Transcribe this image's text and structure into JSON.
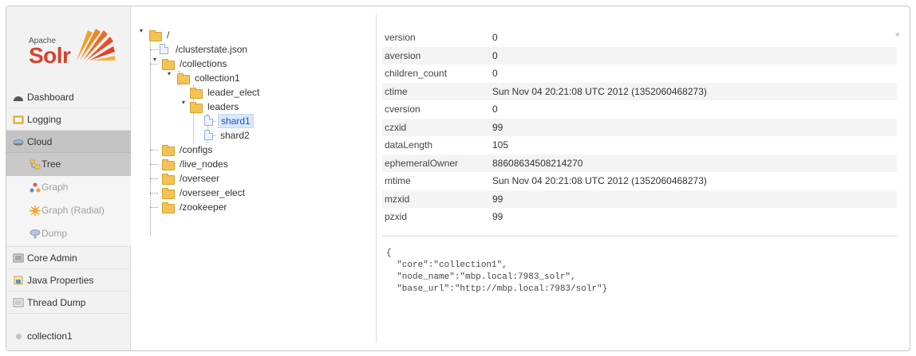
{
  "logo": {
    "apache": "Apache",
    "solr": "Solr"
  },
  "sidebar": {
    "items": [
      {
        "label": "Dashboard",
        "icon": "dashboard-icon"
      },
      {
        "label": "Logging",
        "icon": "logging-icon"
      },
      {
        "label": "Cloud",
        "icon": "cloud-icon",
        "active": true
      }
    ],
    "cloud_sub": [
      {
        "label": "Tree",
        "icon": "tree-icon",
        "selected": true
      },
      {
        "label": "Graph",
        "icon": "graph-icon"
      },
      {
        "label": "Graph (Radial)",
        "icon": "graph-radial-icon"
      },
      {
        "label": "Dump",
        "icon": "dump-icon"
      }
    ],
    "items2": [
      {
        "label": "Core Admin",
        "icon": "core-admin-icon"
      },
      {
        "label": "Java Properties",
        "icon": "java-properties-icon"
      },
      {
        "label": "Thread Dump",
        "icon": "thread-dump-icon"
      }
    ],
    "core": "collection1"
  },
  "tree": {
    "root": "/",
    "nodes": [
      {
        "label": "/clusterstate.json",
        "type": "file"
      },
      {
        "label": "/collections",
        "type": "folder"
      },
      {
        "label": "collection1",
        "type": "folder"
      },
      {
        "label": "leader_elect",
        "type": "folder"
      },
      {
        "label": "leaders",
        "type": "folder"
      },
      {
        "label": "shard1",
        "type": "file",
        "selected": true
      },
      {
        "label": "shard2",
        "type": "file"
      },
      {
        "label": "/configs",
        "type": "folder"
      },
      {
        "label": "/live_nodes",
        "type": "folder"
      },
      {
        "label": "/overseer",
        "type": "folder"
      },
      {
        "label": "/overseer_elect",
        "type": "folder"
      },
      {
        "label": "/zookeeper",
        "type": "folder"
      }
    ]
  },
  "properties": [
    {
      "key": "version",
      "value": "0"
    },
    {
      "key": "aversion",
      "value": "0"
    },
    {
      "key": "children_count",
      "value": "0"
    },
    {
      "key": "ctime",
      "value": "Sun Nov 04 20:21:08 UTC 2012 (1352060468273)"
    },
    {
      "key": "cversion",
      "value": "0"
    },
    {
      "key": "czxid",
      "value": "99"
    },
    {
      "key": "dataLength",
      "value": "105"
    },
    {
      "key": "ephemeralOwner",
      "value": "88608634508214270"
    },
    {
      "key": "mtime",
      "value": "Sun Nov 04 20:21:08 UTC 2012 (1352060468273)"
    },
    {
      "key": "mzxid",
      "value": "99"
    },
    {
      "key": "pzxid",
      "value": "99"
    }
  ],
  "close_label": "×",
  "json_content": "{\n  \"core\":\"collection1\",\n  \"node_name\":\"mbp.local:7983_solr\",\n  \"base_url\":\"http://mbp.local:7983/solr\"}"
}
